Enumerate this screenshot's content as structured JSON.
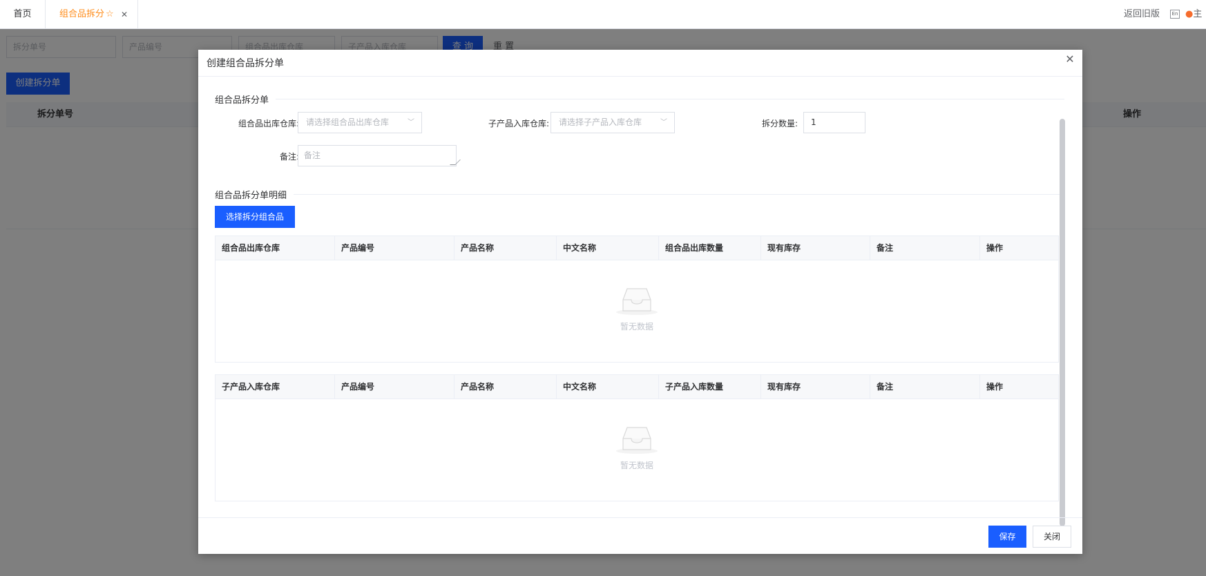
{
  "tabs": {
    "home": "首页",
    "active": "组合品拆分",
    "star_icon": "star-icon",
    "close_icon": "close-icon"
  },
  "header_right": {
    "back_old": "返回旧版",
    "lang_badge": "En",
    "theme_label": "主"
  },
  "filters": {
    "split_no_placeholder": "拆分单号",
    "product_code_placeholder": "产品编号",
    "combo_out_warehouse_placeholder": "组合品出库仓库",
    "child_in_warehouse_placeholder": "子产品入库仓库",
    "query_label": "查 询",
    "reset_label": "重 置"
  },
  "page": {
    "create_button": "创建拆分单",
    "table_columns": {
      "split_no": "拆分单号",
      "actions": "操作"
    }
  },
  "dialog": {
    "title": "创建组合品拆分单",
    "close_icon": "close-icon",
    "section_main": "组合品拆分单",
    "form": {
      "combo_out_label": "组合品出库仓库:",
      "combo_out_placeholder": "请选择组合品出库仓库",
      "child_in_label": "子产品入库仓库:",
      "child_in_placeholder": "请选择子产品入库仓库",
      "qty_label": "拆分数量:",
      "qty_value": "1",
      "remark_label": "备注:",
      "remark_placeholder": "备注"
    },
    "section_detail": "组合品拆分单明细",
    "select_combo_button": "选择拆分组合品",
    "combo_table": {
      "columns": [
        "组合品出库仓库",
        "产品编号",
        "产品名称",
        "中文名称",
        "组合品出库数量",
        "现有库存",
        "备注",
        "操作"
      ],
      "empty_text": "暂无数据"
    },
    "child_table": {
      "columns": [
        "子产品入库仓库",
        "产品编号",
        "产品名称",
        "中文名称",
        "子产品入库数量",
        "现有库存",
        "备注",
        "操作"
      ],
      "empty_text": "暂无数据"
    },
    "footer": {
      "save_label": "保存",
      "close_label": "关闭"
    }
  }
}
